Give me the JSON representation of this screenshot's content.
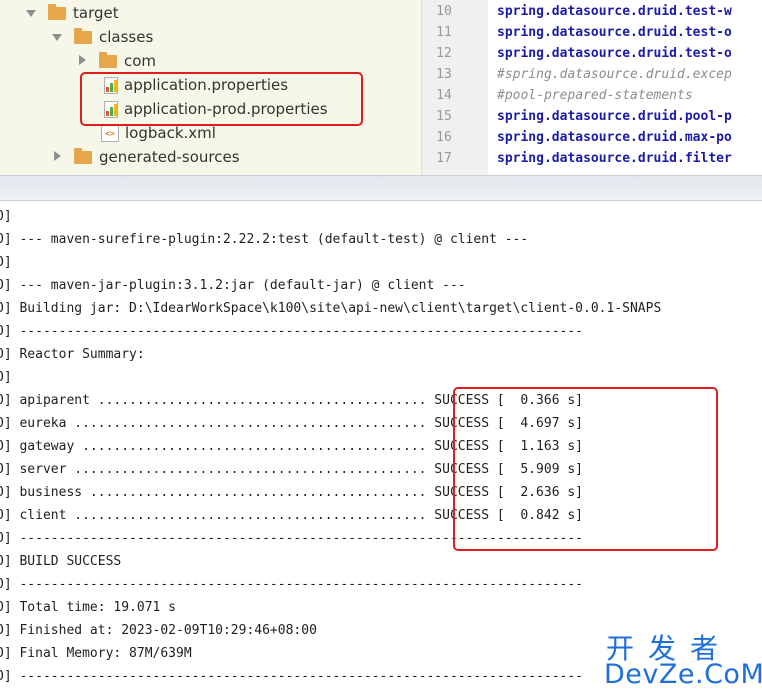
{
  "tree": {
    "items": [
      {
        "label": "target",
        "kind": "folder",
        "arrow": "down"
      },
      {
        "label": "classes",
        "kind": "folder",
        "arrow": "down"
      },
      {
        "label": "com",
        "kind": "folder",
        "arrow": "right"
      },
      {
        "label": "application.properties",
        "kind": "properties",
        "arrow": "none"
      },
      {
        "label": "application-prod.properties",
        "kind": "properties",
        "arrow": "none"
      },
      {
        "label": "logback.xml",
        "kind": "xml",
        "arrow": "none"
      },
      {
        "label": "generated-sources",
        "kind": "folder",
        "arrow": "right"
      }
    ]
  },
  "editor": {
    "line_numbers": [
      "10",
      "11",
      "12",
      "13",
      "14",
      "15",
      "16",
      "17"
    ],
    "lines": [
      {
        "text": "spring.datasource.druid.test-w",
        "comment": false
      },
      {
        "text": "spring.datasource.druid.test-o",
        "comment": false
      },
      {
        "text": "spring.datasource.druid.test-o",
        "comment": false
      },
      {
        "text": "#spring.datasource.druid.excep",
        "comment": true
      },
      {
        "text": "#pool-prepared-statements",
        "comment": true
      },
      {
        "text": "spring.datasource.druid.pool-p",
        "comment": false
      },
      {
        "text": "spring.datasource.druid.max-po",
        "comment": false
      },
      {
        "text": "spring.datasource.druid.filter",
        "comment": false
      }
    ]
  },
  "console": {
    "lines": [
      "O]",
      "O] --- maven-surefire-plugin:2.22.2:test (default-test) @ client ---",
      "O]",
      "O] --- maven-jar-plugin:3.1.2:jar (default-jar) @ client ---",
      "O] Building jar: D:\\IdearWorkSpace\\k100\\site\\api-new\\client\\target\\client-0.0.1-SNAPS",
      "O] ------------------------------------------------------------------------",
      "O] Reactor Summary:",
      "O]",
      "O] apiparent .......................................... SUCCESS [  0.366 s]",
      "O] eureka ............................................. SUCCESS [  4.697 s]",
      "O] gateway ............................................ SUCCESS [  1.163 s]",
      "O] server ............................................. SUCCESS [  5.909 s]",
      "O] business ........................................... SUCCESS [  2.636 s]",
      "O] client ............................................. SUCCESS [  0.842 s]",
      "O] ------------------------------------------------------------------------",
      "O] BUILD SUCCESS",
      "O] ------------------------------------------------------------------------",
      "O] Total time: 19.071 s",
      "O] Finished at: 2023-02-09T10:29:46+08:00",
      "O] Final Memory: 87M/639M",
      "O] ------------------------------------------------------------------------"
    ]
  },
  "watermark": {
    "cn": "开发者",
    "en": "DevZe.CoM"
  },
  "colors": {
    "highlight_box": "#e01d1d",
    "tree_background": "#f7f7e9",
    "folder": "#e8a64a",
    "code_keyword": "#1b1ba8",
    "code_comment": "#8c8c8c",
    "watermark": "#1e6fd9"
  }
}
